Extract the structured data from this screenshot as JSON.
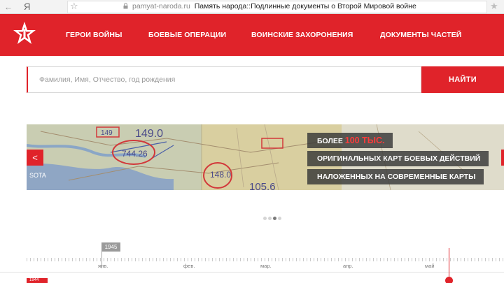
{
  "browser": {
    "back_glyph": "←",
    "logo_text": "Я",
    "star_glyph": "☆",
    "domain": "pamyat-naroda.ru",
    "page_title": "Память народа::Подлинные документы о Второй Мировой войне",
    "bookmark_glyph": "★"
  },
  "header": {
    "logo_icon": "red-star-icon",
    "nav": [
      "ГЕРОИ ВОЙНЫ",
      "БОЕВЫЕ ОПЕРАЦИИ",
      "ВОИНСКИЕ ЗАХОРОНЕНИЯ",
      "ДОКУМЕНТЫ ЧАСТЕЙ"
    ]
  },
  "search": {
    "placeholder": "Фамилия, Имя, Отчество, год рождения",
    "value": "",
    "button_label": "НАЙТИ"
  },
  "banner": {
    "caption_1_prefix": "БОЛЕЕ ",
    "caption_1_highlight": "100 ТЫС.",
    "caption_2": "ОРИГИНАЛЬНЫХ КАРТ БОЕВЫХ ДЕЙСТВИЙ",
    "caption_3": "НАЛОЖЕННЫХ НА СОВРЕМЕННЫЕ КАРТЫ",
    "map_labels": [
      "149",
      "149.0",
      "744.26",
      "148.0",
      "105.6",
      "SOTA"
    ],
    "prev_glyph": "<",
    "next_glyph": ">"
  },
  "carousel": {
    "slides": 4,
    "active_index": 2
  },
  "timeline": {
    "year_badge": "1945",
    "year_badge_lower": "1944",
    "months": [
      "янв.",
      "фев.",
      "мар.",
      "апр.",
      "май"
    ]
  },
  "colors": {
    "brand_red": "#e0232a",
    "highlight_red": "#ff3b3b",
    "caption_bg": "#373737"
  }
}
